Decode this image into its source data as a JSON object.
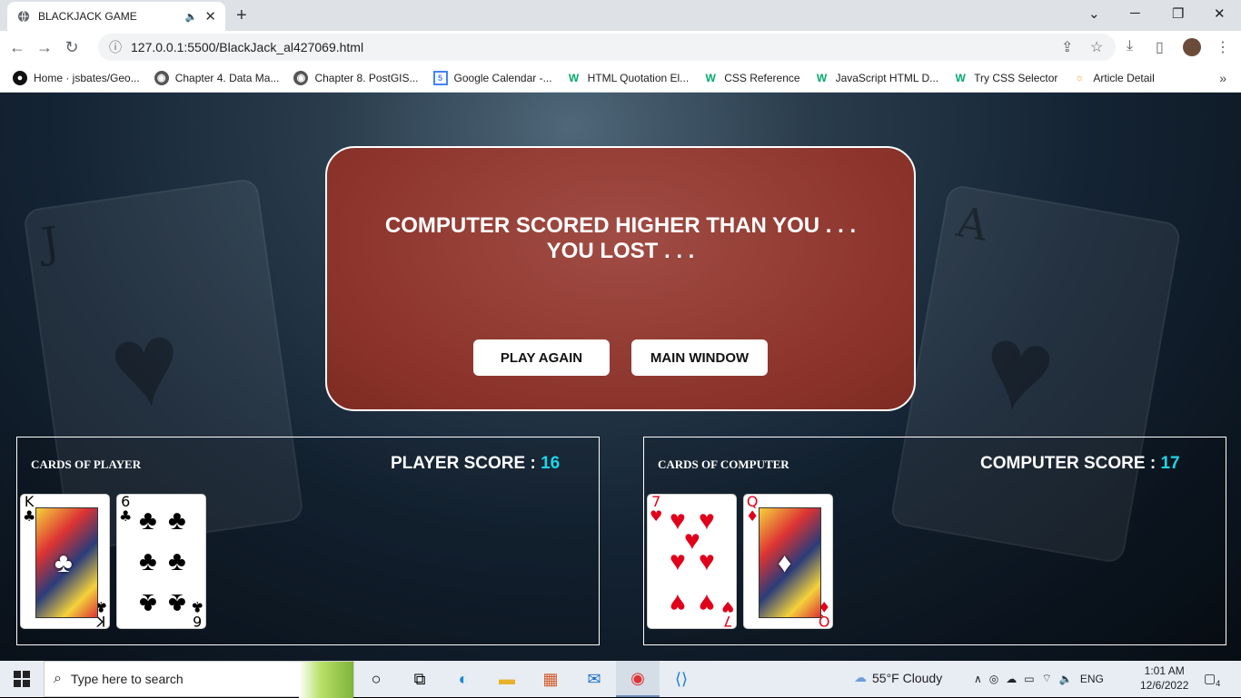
{
  "browser": {
    "tab_title": "BLACKJACK GAME",
    "url": "127.0.0.1:5500/BlackJack_al427069.html",
    "bookmarks": [
      {
        "icon": "github-icon",
        "label": "Home · jsbates/Geo..."
      },
      {
        "icon": "globe-icon",
        "label": "Chapter 4. Data Ma..."
      },
      {
        "icon": "globe-icon",
        "label": "Chapter 8. PostGIS..."
      },
      {
        "icon": "calendar-icon",
        "label": "Google Calendar -..."
      },
      {
        "icon": "w3schools-icon",
        "label": "HTML Quotation El..."
      },
      {
        "icon": "w3schools-icon",
        "label": "CSS Reference"
      },
      {
        "icon": "w3schools-icon",
        "label": "JavaScript HTML D..."
      },
      {
        "icon": "w3schools-icon",
        "label": "Try CSS Selector"
      },
      {
        "icon": "article-icon",
        "label": "Article Detail"
      }
    ]
  },
  "game": {
    "result_line1": "COMPUTER SCORED HIGHER THAN YOU . . .",
    "result_line2": "YOU LOST . . .",
    "play_again_label": "PLAY AGAIN",
    "main_window_label": "MAIN WINDOW",
    "background_cards": {
      "left_rank": "J",
      "right_rank": "A"
    },
    "player": {
      "label": "CARDS OF PLAYER",
      "score_label": "PLAYER SCORE : ",
      "score": "16",
      "cards": [
        {
          "rank": "K",
          "suit": "♣",
          "color": "black",
          "face": true
        },
        {
          "rank": "6",
          "suit": "♣",
          "color": "black",
          "face": false
        }
      ]
    },
    "computer": {
      "label": "CARDS OF COMPUTER",
      "score_label": "COMPUTER SCORE : ",
      "score": "17",
      "cards": [
        {
          "rank": "7",
          "suit": "♥",
          "color": "red",
          "face": false
        },
        {
          "rank": "Q",
          "suit": "♦",
          "color": "red",
          "face": true
        }
      ]
    }
  },
  "taskbar": {
    "search_placeholder": "Type here to search",
    "weather": "55°F  Cloudy",
    "lang": "ENG",
    "time": "1:01 AM",
    "date": "12/6/2022",
    "notifications": "4"
  },
  "colors": {
    "modal": "#8c342b",
    "score_accent": "#1fd5e8"
  }
}
